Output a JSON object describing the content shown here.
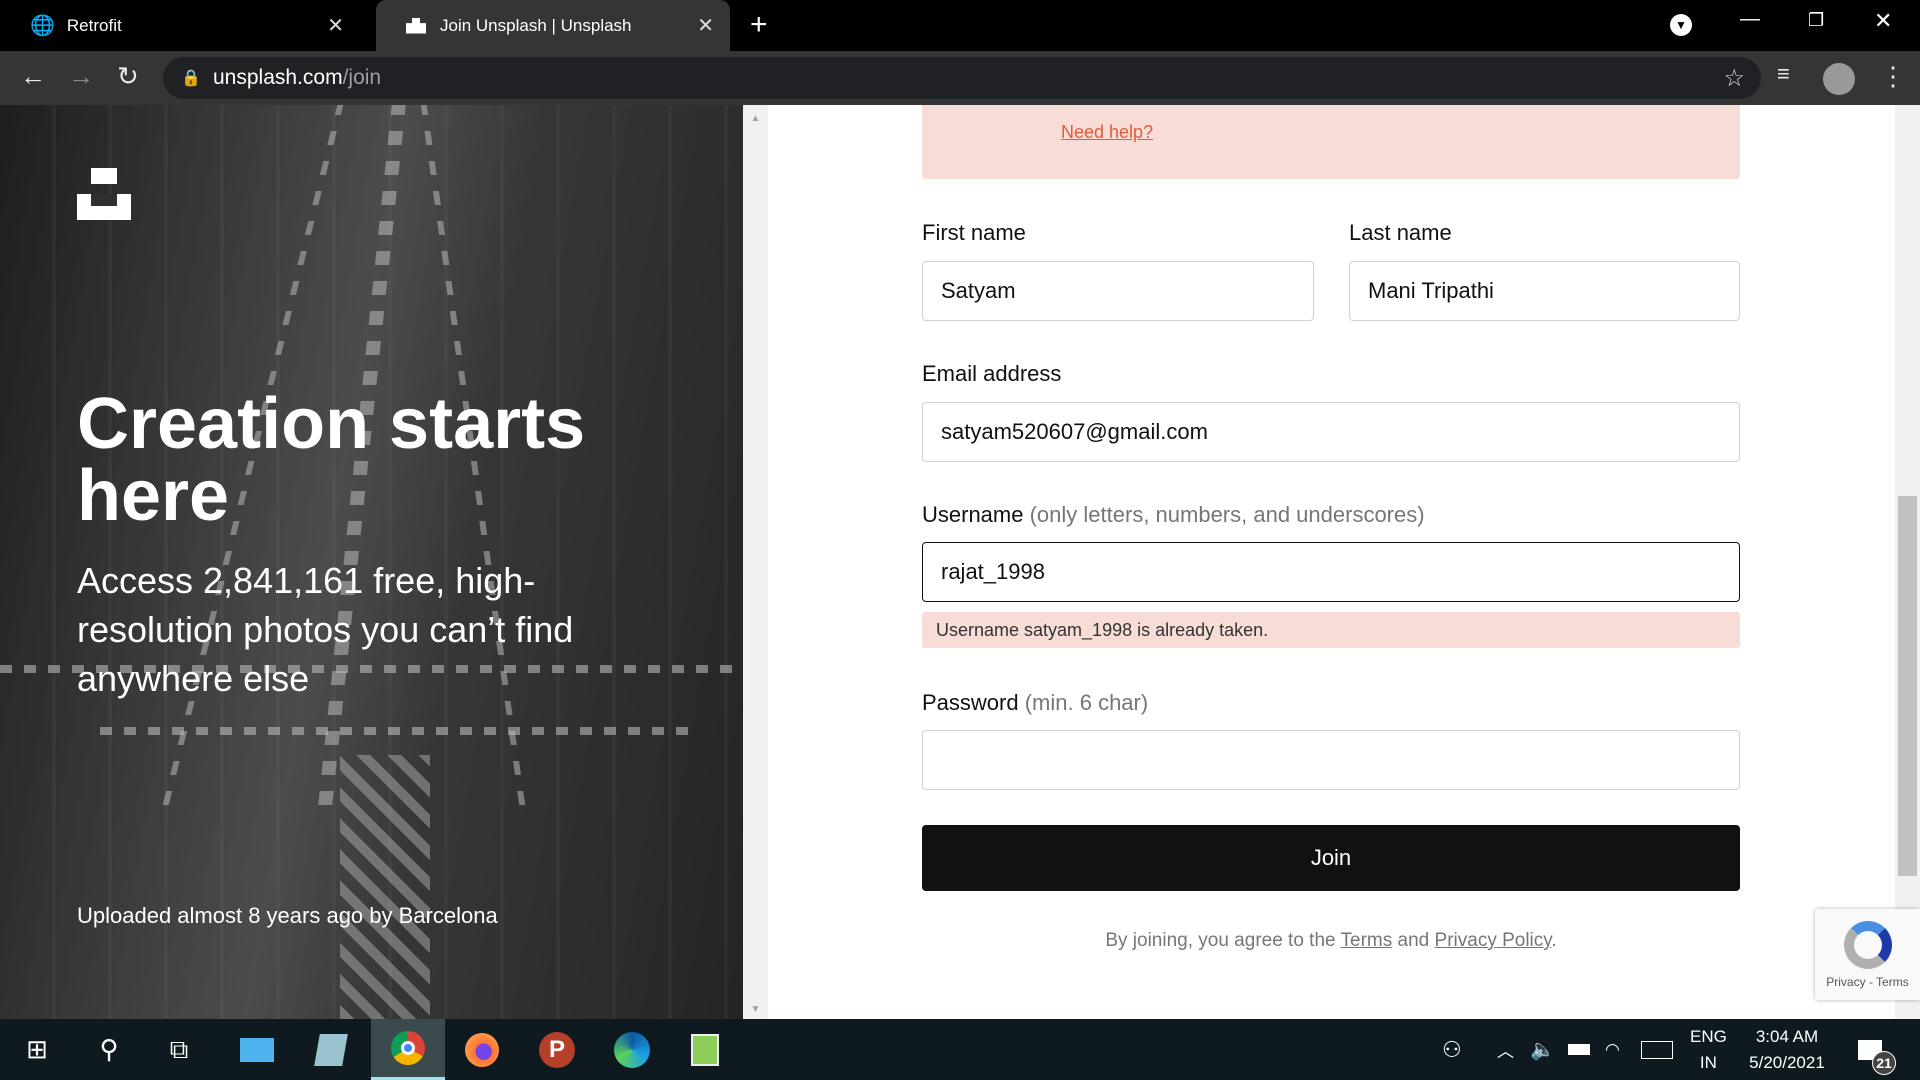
{
  "browser": {
    "tabs": [
      {
        "title": "Retrofit",
        "icon": "globe-icon"
      },
      {
        "title": "Join Unsplash | Unsplash",
        "icon": "unsplash-icon",
        "active": true
      }
    ],
    "url_host": "unsplash.com",
    "url_path": "/join"
  },
  "hero": {
    "headline": "Creation starts here",
    "subtitle": "Access 2,841,161 free, high-resolution photos you can’t find anywhere else",
    "credit": "Uploaded almost 8 years ago by Barcelona"
  },
  "form": {
    "need_help": "Need help?",
    "first_name_label": "First name",
    "first_name": "Satyam",
    "last_name_label": "Last name",
    "last_name": "Mani Tripathi",
    "email_label": "Email address",
    "email": "satyam520607@gmail.com",
    "username_label": "Username",
    "username_hint": "(only letters, numbers, and underscores)",
    "username": "rajat_1998",
    "username_error": "Username satyam_1998 is already taken.",
    "password_label": "Password",
    "password_hint": "(min. 6 char)",
    "password": "",
    "join_label": "Join",
    "terms_prefix": "By joining, you agree to the",
    "terms_link": "Terms",
    "terms_and": "and",
    "privacy_link": "Privacy Policy",
    "terms_suffix": "."
  },
  "recaptcha": {
    "text": "Privacy - Terms"
  },
  "taskbar": {
    "lang1": "ENG",
    "lang2": "IN",
    "time": "3:04 AM",
    "date": "5/20/2021",
    "notifications": "21"
  },
  "colors": {
    "error_bg": "#f8dcd6",
    "link": "#e25c3d",
    "button": "#111111"
  }
}
